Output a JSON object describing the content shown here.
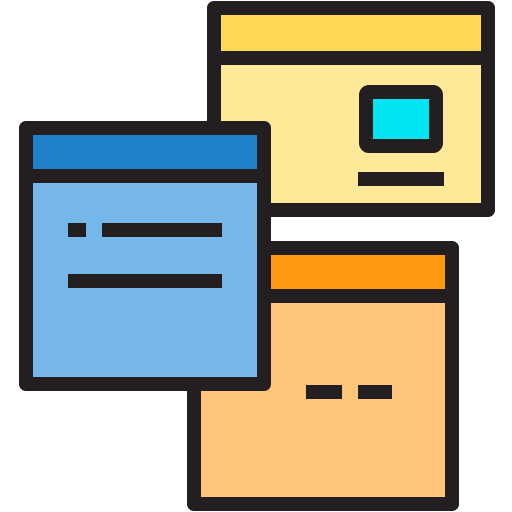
{
  "icon": {
    "name": "multiple-windows-icon",
    "colors": {
      "outline": "#231f20",
      "back_window_titlebar": "#ffd956",
      "back_window_body": "#ffe897",
      "screen_fill": "#00e5f0",
      "front_window_titlebar": "#1f80cc",
      "front_window_body": "#76b7ea",
      "bottom_window_titlebar": "#ff9811",
      "bottom_window_body": "#ffc57a",
      "background": "#ffffff"
    }
  }
}
